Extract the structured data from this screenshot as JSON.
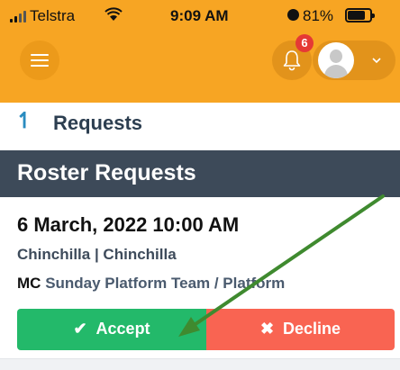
{
  "status_bar": {
    "carrier": "Telstra",
    "time": "9:09 AM",
    "battery_percent": "81%",
    "battery_level": 0.81,
    "icons": [
      "signal-icon",
      "wifi-icon",
      "alarm-icon",
      "battery-icon"
    ]
  },
  "header": {
    "accent_color": "#f7a523",
    "notification_count": "6",
    "icons": [
      "hamburger-menu-icon",
      "bell-icon",
      "user-avatar-icon",
      "chevron-down-icon"
    ]
  },
  "page": {
    "title": "Requests",
    "back_icon": "up-arrow-icon"
  },
  "section": {
    "title": "Roster Requests",
    "background": "#3d4a59"
  },
  "request": {
    "datetime": "6 March, 2022 10:00 AM",
    "location": "Chinchilla | Chinchilla",
    "role_code": "MC",
    "team": "Sunday Platform Team / Platform",
    "accept_label": "Accept",
    "accept_icon": "check-icon",
    "accept_color": "#23b96a",
    "decline_label": "Decline",
    "decline_icon": "times-icon",
    "decline_color": "#f96452"
  },
  "annotation": {
    "arrow_color": "#3f8a2f"
  }
}
